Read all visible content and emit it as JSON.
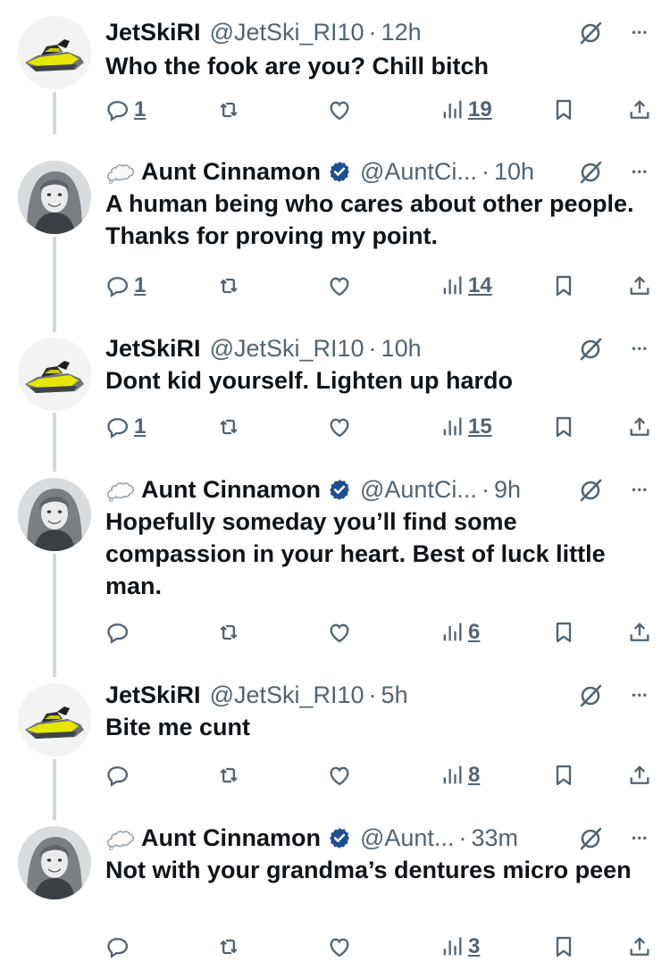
{
  "tweets": [
    {
      "author": "JetSkiRI",
      "handle": "@JetSki_RI10",
      "time": "12h",
      "avatar": "jetski",
      "verified": false,
      "text": "Who the fook are you? Chill bitch",
      "replies": "1",
      "retweets": "",
      "likes": "",
      "views": "19"
    },
    {
      "author": "Aunt Cinnamon",
      "handle": "@AuntCi...",
      "time": "10h",
      "avatar": "woman",
      "verified": true,
      "text": "A human being who cares about other people. Thanks for proving my point.",
      "replies": "1",
      "retweets": "",
      "likes": "",
      "views": "14"
    },
    {
      "author": "JetSkiRI",
      "handle": "@JetSki_RI10",
      "time": "10h",
      "avatar": "jetski",
      "verified": false,
      "text": "Dont kid yourself. Lighten up hardo",
      "replies": "1",
      "retweets": "",
      "likes": "",
      "views": "15"
    },
    {
      "author": "Aunt Cinnamon",
      "handle": "@AuntCi...",
      "time": "9h",
      "avatar": "woman",
      "verified": true,
      "text": "Hopefully someday you’ll find some compassion in your heart. Best of luck little man.",
      "replies": "",
      "retweets": "",
      "likes": "",
      "views": "6"
    },
    {
      "author": "JetSkiRI",
      "handle": "@JetSki_RI10",
      "time": "5h",
      "avatar": "jetski",
      "verified": false,
      "text": "Bite me cunt",
      "replies": "",
      "retweets": "",
      "likes": "",
      "views": "8"
    },
    {
      "author": "Aunt Cinnamon",
      "handle": "@Aunt...",
      "time": "33m",
      "avatar": "woman",
      "verified": true,
      "text": "Not with your grandma’s dentures micro peen",
      "replies": "",
      "retweets": "",
      "likes": "",
      "views": "3"
    }
  ],
  "colors": {
    "text": "#0f1419",
    "muted": "#536471",
    "verified": "#1d4f91",
    "thread_line": "#cfd9de",
    "jetski_yellow": "#e6e600"
  },
  "icons": {
    "reply": "reply-icon",
    "retweet": "retweet-icon",
    "like": "heart-icon",
    "views": "views-icon",
    "bookmark": "bookmark-icon",
    "share": "share-icon",
    "grok": "grok-icon",
    "more": "more-icon",
    "cloud": "cloud-emoji-icon",
    "verified": "verified-badge-icon"
  }
}
